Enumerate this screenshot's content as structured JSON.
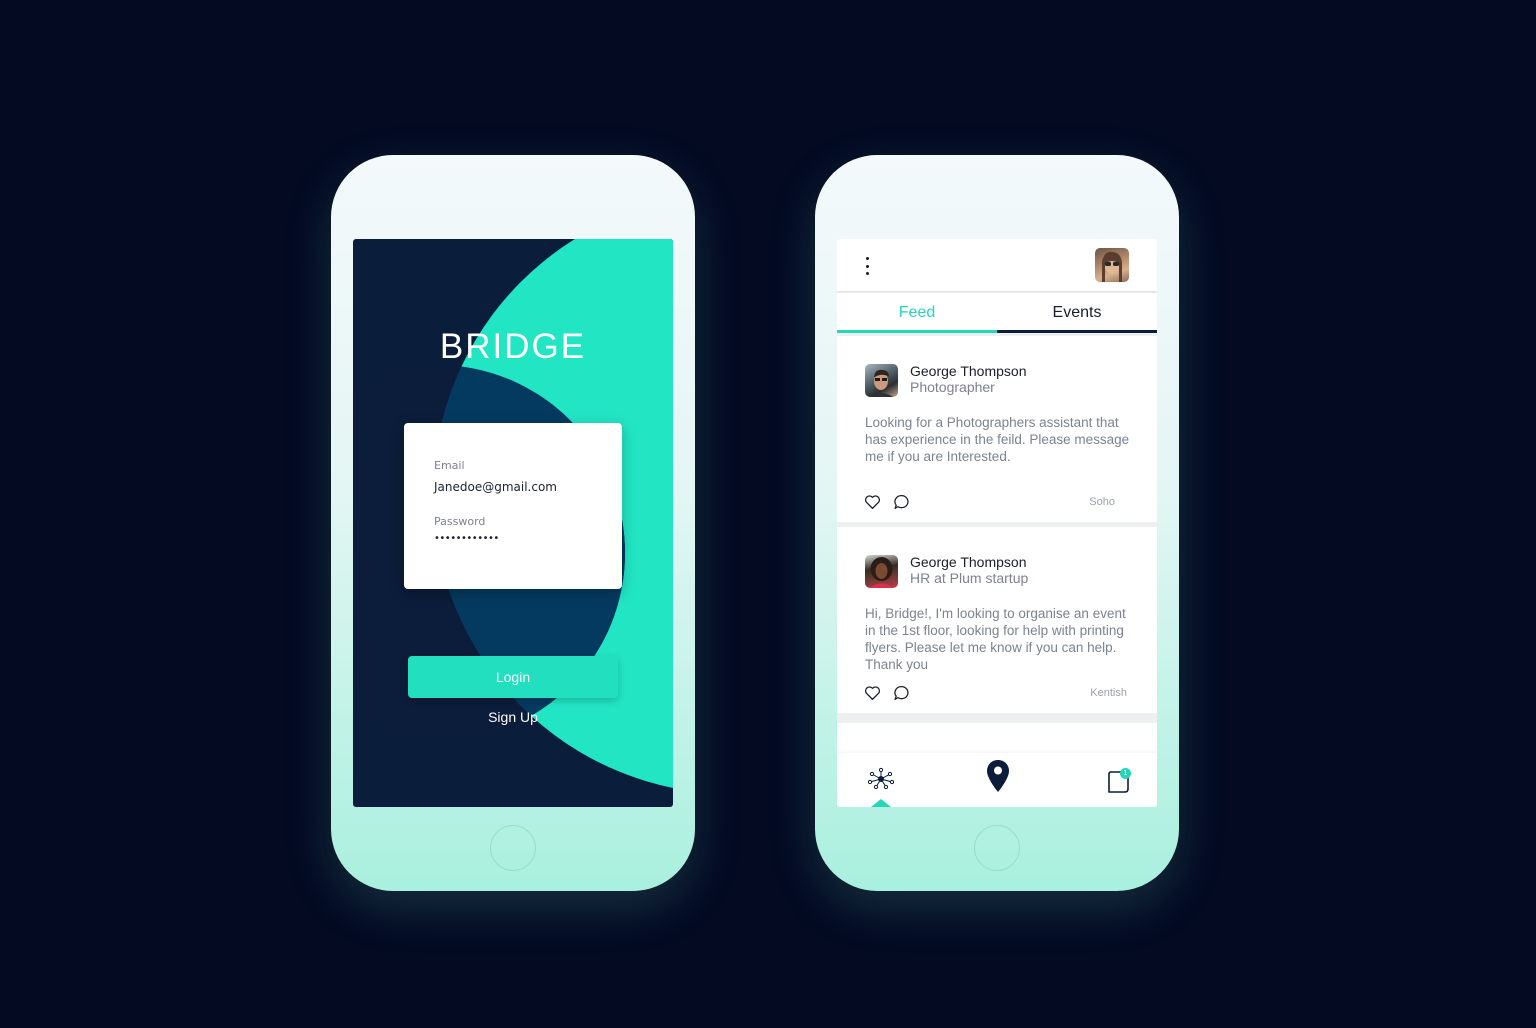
{
  "colors": {
    "background": "#030a22",
    "accent": "#22e5c4",
    "navy": "#0b1d3a",
    "text_muted": "#7c8290"
  },
  "login": {
    "brand": "BRIDGE",
    "email_label": "Email",
    "email_value": "Janedoe@gmail.com",
    "password_label": "Password",
    "password_value": "••••••••••••",
    "login_button": "Login",
    "signup_link": "Sign Up"
  },
  "feed": {
    "menu_icon": "kebab-menu-icon",
    "tabs": [
      {
        "label": "Feed",
        "active": true
      },
      {
        "label": "Events",
        "active": false
      }
    ],
    "posts": [
      {
        "name": "George Thompson",
        "role": "Photographer",
        "body": "Looking for a Photographers assistant that has experience in the feild. Please message me if you are Interested.",
        "location": "Soho"
      },
      {
        "name": "George Thompson",
        "role": "HR at Plum startup",
        "body": "Hi, Bridge!, I'm looking to organise an event in the 1st floor, looking for help with printing flyers. Please let me know if you can help. Thank you",
        "location": "Kentish"
      }
    ],
    "bottom_nav": {
      "items": [
        "network-icon",
        "map-pin-icon",
        "chat-icon"
      ],
      "badge": "1"
    }
  }
}
